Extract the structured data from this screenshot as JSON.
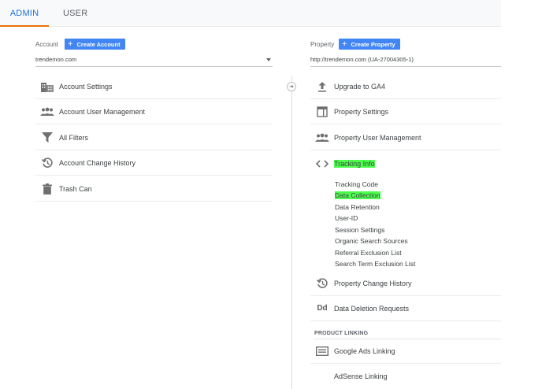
{
  "tabs": {
    "admin": "ADMIN",
    "user": "USER"
  },
  "account": {
    "label": "Account",
    "create_label": "Create Account",
    "selected": "trendemon.com",
    "items": [
      {
        "label": "Account Settings",
        "icon": "building-icon"
      },
      {
        "label": "Account User Management",
        "icon": "people-icon"
      },
      {
        "label": "All Filters",
        "icon": "filter-icon"
      },
      {
        "label": "Account Change History",
        "icon": "history-icon"
      },
      {
        "label": "Trash Can",
        "icon": "trash-icon"
      }
    ]
  },
  "property": {
    "label": "Property",
    "create_label": "Create Property",
    "selected": "http://trendemon.com (UA-27004305-1)",
    "items": [
      {
        "label": "Upgrade to GA4",
        "icon": "upload-icon"
      },
      {
        "label": "Property Settings",
        "icon": "settings-window-icon"
      },
      {
        "label": "Property User Management",
        "icon": "people-icon"
      },
      {
        "label": "Tracking Info",
        "icon": "code-icon"
      }
    ],
    "tracking_sub": [
      "Tracking Code",
      "Data Collection",
      "Data Retention",
      "User-ID",
      "Session Settings",
      "Organic Search Sources",
      "Referral Exclusion List",
      "Search Term Exclusion List"
    ],
    "more_items": [
      {
        "label": "Property Change History",
        "icon": "history-icon"
      },
      {
        "label": "Data Deletion Requests",
        "icon": "dd-icon",
        "icon_text": "Dd"
      }
    ],
    "product_linking_heading": "PRODUCT LINKING",
    "linking": [
      {
        "label": "Google Ads Linking",
        "icon": "google-ads-icon"
      },
      {
        "label": "AdSense Linking",
        "icon": "adsense-icon"
      }
    ]
  },
  "colors": {
    "accent_blue": "#4285f4",
    "active_tab_text": "#1a73e8",
    "active_tab_underline": "#e8710a",
    "highlight": "#4cff4c"
  }
}
